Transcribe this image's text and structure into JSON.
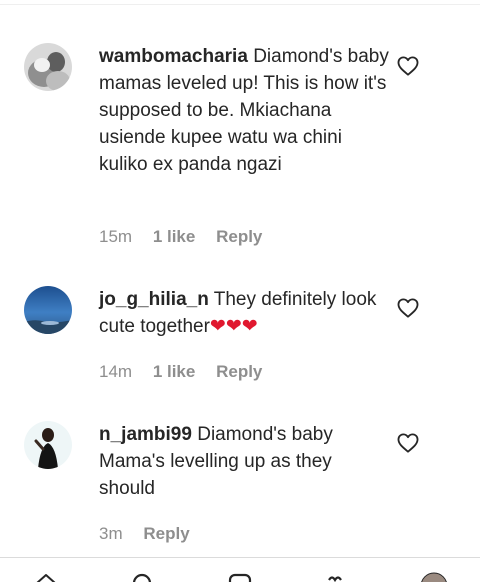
{
  "comments": [
    {
      "username": "wambomacharia",
      "text": "Diamond's baby mamas leveled up! This is how it's supposed to be. Mkiachana usiende kupee watu wa chini kuliko ex panda ngazi",
      "time": "15m",
      "likes": "1 like",
      "reply": "Reply"
    },
    {
      "username": "jo_g_hilia_n",
      "text": "They definitely look cute together",
      "hearts": "❤❤❤",
      "time": "14m",
      "likes": "1 like",
      "reply": "Reply"
    },
    {
      "username": "n_jambi99",
      "text": "Diamond's baby Mama's levelling up as they should",
      "time": "3m",
      "reply": "Reply"
    }
  ],
  "icons": {
    "like": "heart-outline-icon",
    "nav": [
      "home-icon",
      "search-icon",
      "reels-icon",
      "shop-icon",
      "profile-avatar"
    ]
  },
  "colors": {
    "text": "#262626",
    "meta": "#8e8e8e",
    "heart_emoji": "#e0182f"
  }
}
